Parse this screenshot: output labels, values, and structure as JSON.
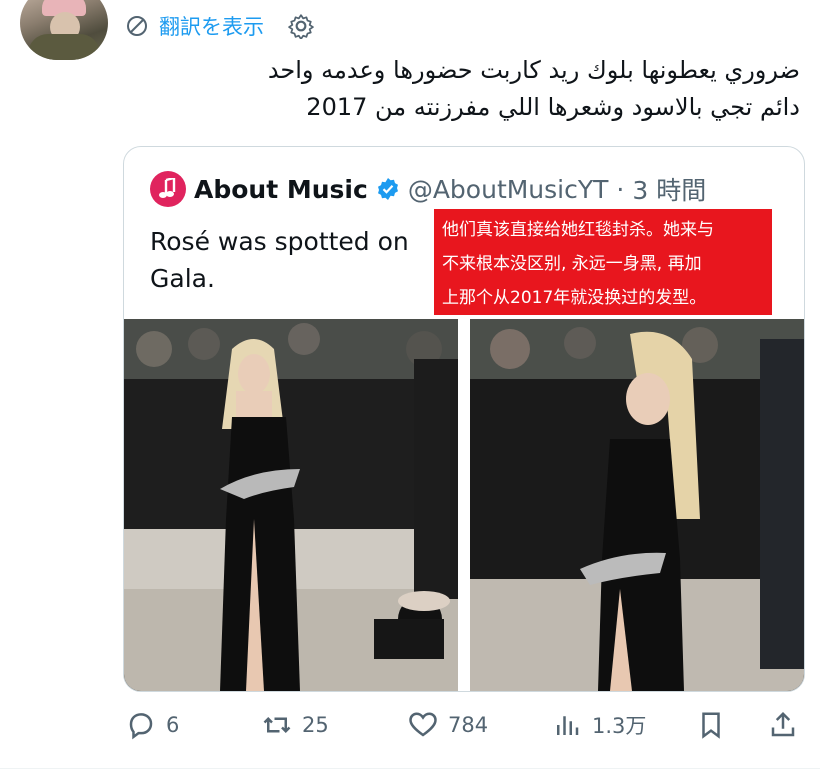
{
  "translate": {
    "label": "翻訳を表示"
  },
  "tweet": {
    "text": "ضروري يعطونها بلوك ريد كاربت حضورها وعدمه واحد\nدائم تجي بالاسود وشعرها اللي مفرزنته من 2017"
  },
  "quote": {
    "author_name": "About Music",
    "handle": "@AboutMusicYT",
    "separator": "·",
    "time": "3 時間",
    "text": "Rosé was spotted on\nGala.",
    "overlay_text": "他们真该直接给她红毯封杀。她来与\n不来根本没区别, 永远一身黑, 再加\n上那个从2017年就没换过的发型。"
  },
  "actions": {
    "replies": "6",
    "retweets": "25",
    "likes": "784",
    "views": "1.3万"
  },
  "colors": {
    "accent": "#1d9bf0",
    "muted": "#536471",
    "overlay_red": "#e8161e",
    "music_badge": "#e0245e"
  },
  "icons": [
    "translate-globe-icon",
    "settings-gear-icon",
    "music-note-icon",
    "verified-badge-icon",
    "reply-icon",
    "retweet-icon",
    "like-icon",
    "views-icon",
    "bookmark-icon",
    "share-icon"
  ]
}
